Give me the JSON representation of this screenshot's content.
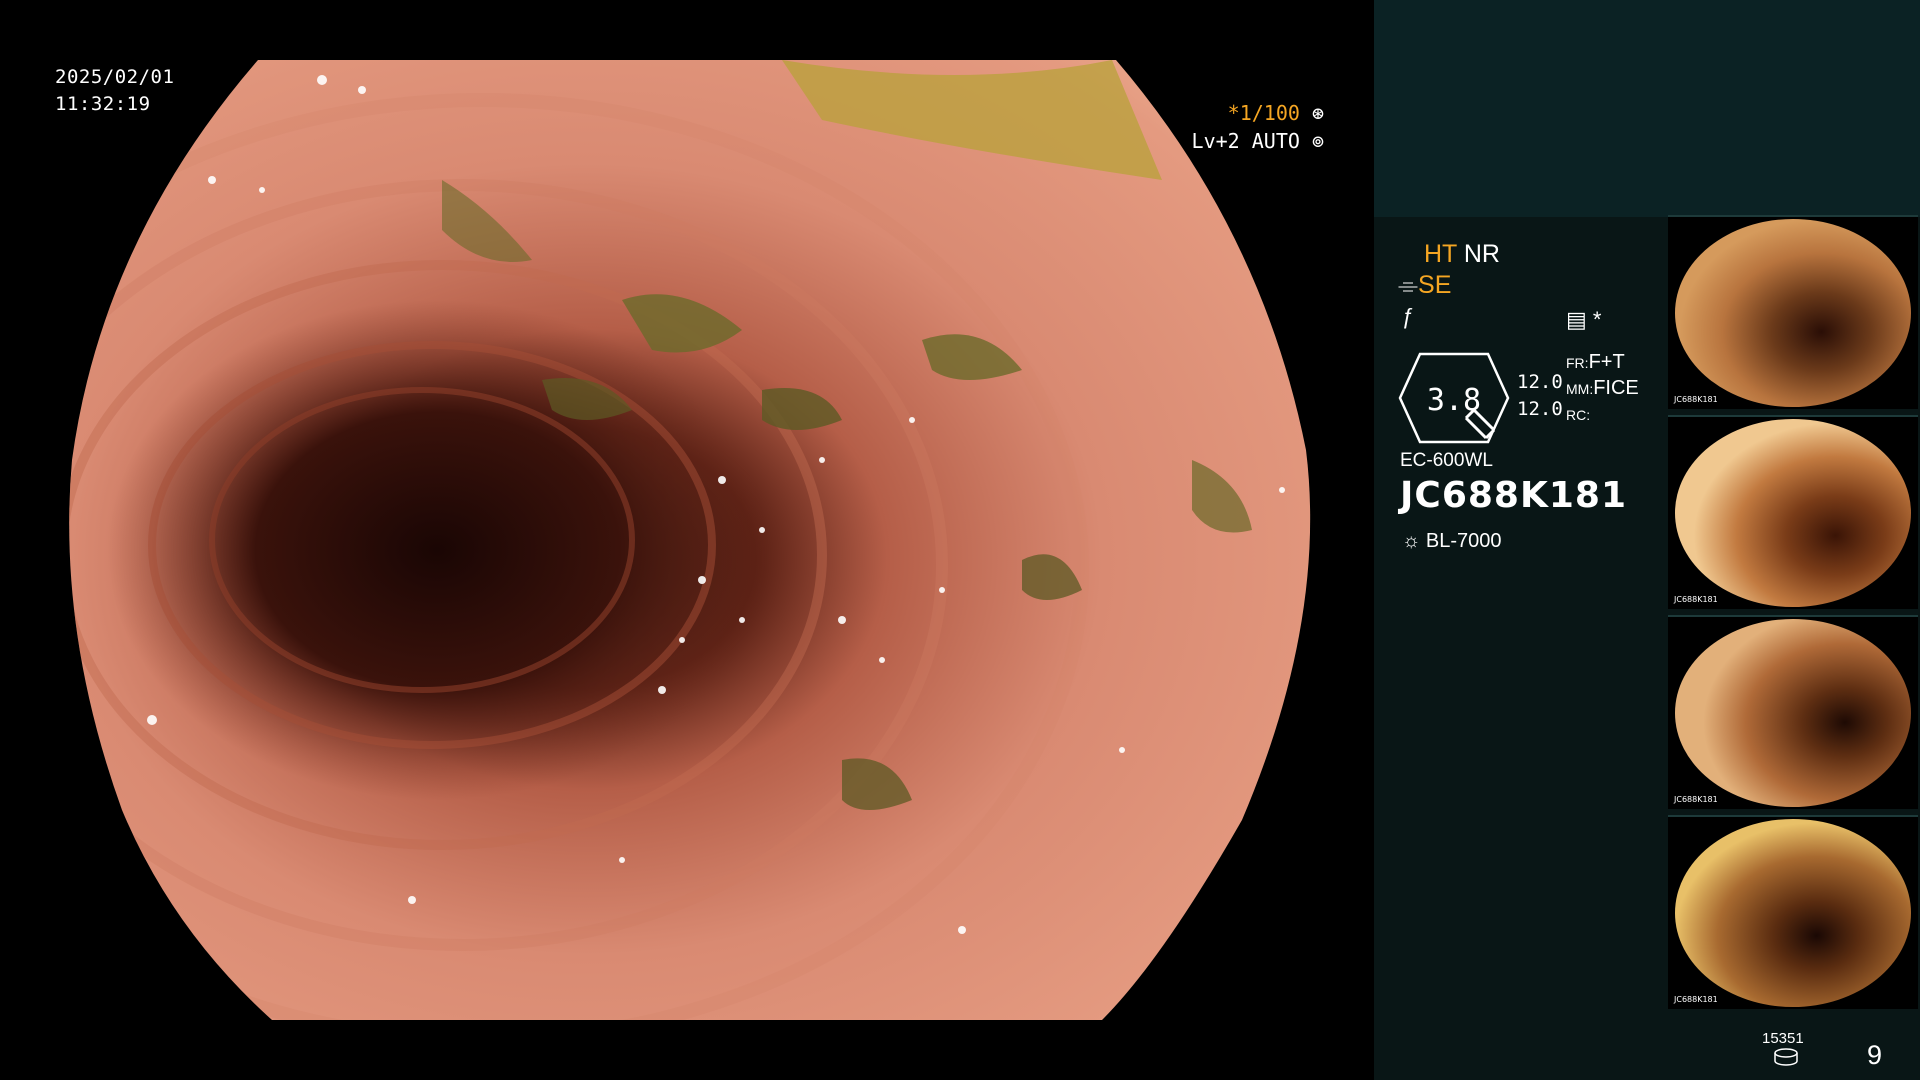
{
  "main_view": {
    "date": "2025/02/01",
    "time": "11:32:19",
    "shutter_speed": "*1/100",
    "enhance_level": "Lv+2 AUTO"
  },
  "info_panel": {
    "ht": "HT",
    "nr": "NR",
    "se": "SE",
    "memo_star": "*",
    "zoom_value": "3.8",
    "zoom_a": "12.0",
    "zoom_b": "12.0",
    "fr_label": "FR:",
    "fr_value": "F+T",
    "mm_label": "MM:",
    "mm_value": "FICE",
    "rc_label": "RC:",
    "scope_model": "EC-600WL",
    "scope_serial": "JC688K181",
    "light_source": "BL-7000"
  },
  "thumbnails": [
    {
      "id": "thumb-1",
      "serial": "JC688K181"
    },
    {
      "id": "thumb-2",
      "serial": "JC688K181"
    },
    {
      "id": "thumb-3",
      "serial": "JC688K181"
    },
    {
      "id": "thumb-4",
      "serial": "JC688K181"
    }
  ],
  "footer": {
    "record_count": "15351",
    "page_number": "9"
  },
  "colors": {
    "accent_orange": "#f5a623",
    "panel_top": "#0b2224",
    "panel_bottom": "#091616"
  }
}
